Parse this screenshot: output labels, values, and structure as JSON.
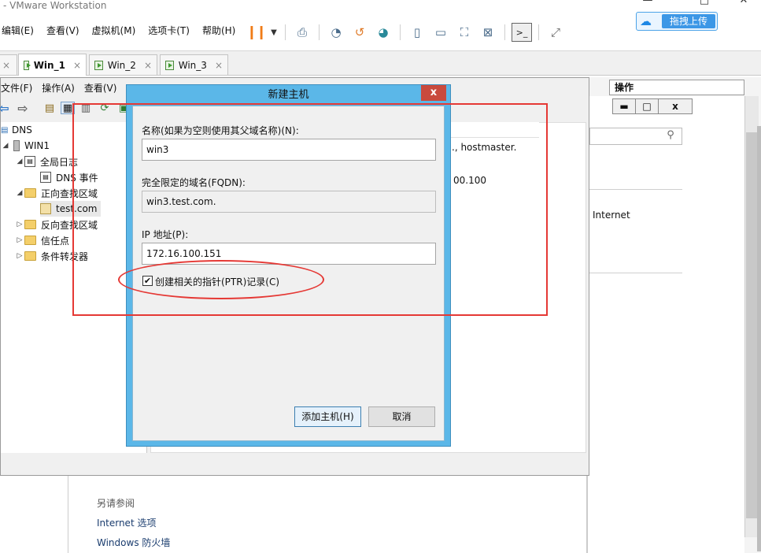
{
  "vmware": {
    "title": "- VMware Workstation",
    "menu": [
      "编辑(E)",
      "查看(V)",
      "虚拟机(M)",
      "选项卡(T)",
      "帮助(H)"
    ],
    "upload_label": "拖拽上传",
    "tabs": [
      "Win_1",
      "Win_2",
      "Win_3"
    ],
    "tab_close": "×"
  },
  "dns_manager": {
    "menu": [
      "文件(F)",
      "操作(A)",
      "查看(V)"
    ],
    "tree": {
      "root": "DNS",
      "server": "WIN1",
      "global_logs": "全局日志",
      "dns_events": "DNS 事件",
      "forward_zones": "正向查找区域",
      "zone": "test.com",
      "reverse_zones": "反向查找区域",
      "trust_points": "信任点",
      "conditional_forwarders": "条件转发器"
    },
    "bg_snippets": {
      "soa": "., hostmaster.",
      "ip_fragment": "00.100",
      "internet": "Internet"
    }
  },
  "action_pane": {
    "header": "操作",
    "controls": [
      "▬",
      "□",
      "x"
    ]
  },
  "lower_page": {
    "see_also": "另请参阅",
    "links": [
      "Internet 选项",
      "Windows 防火墙"
    ]
  },
  "dialog": {
    "title": "新建主机",
    "close": "x",
    "name_label": "名称(如果为空则使用其父域名称)(N):",
    "name_value": "win3",
    "fqdn_label": "完全限定的域名(FQDN):",
    "fqdn_value": "win3.test.com.",
    "ip_label": "IP 地址(P):",
    "ip_value": "172.16.100.151",
    "ptr_checkbox": {
      "label": "创建相关的指针(PTR)记录(C)",
      "checked": true,
      "mark": "✔"
    },
    "add_button": "添加主机(H)",
    "cancel_button": "取消"
  },
  "colors": {
    "dialog_frame": "#5bb7e8",
    "close_button": "#c94a3d",
    "annotation": "#e53935",
    "pause_icon": "#f07b16"
  }
}
